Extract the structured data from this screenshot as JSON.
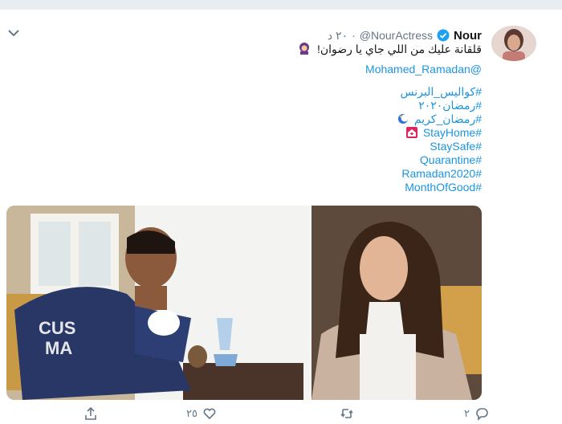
{
  "tweet": {
    "author_name": "Nour",
    "handle": "@NourActress",
    "time": "٢٠ د",
    "separator": "·",
    "text": "قلقانة عليك من اللي جاي يا رضوان!",
    "mention": "@Mohamed_Ramadan",
    "hashtags": [
      "#كواليس_البرنس",
      "#رمضان٢٠٢٠",
      "#رمضان_كريم",
      "#StayHome",
      "#StaySafe",
      "#Quarantine",
      "#Ramadan2020",
      "#MonthOfGood"
    ]
  },
  "actions": {
    "reply_count": "٢",
    "retweet_count": "",
    "like_count": "٢٥",
    "share_count": ""
  },
  "colors": {
    "link": "#1b95e0",
    "text": "#14171a",
    "secondary": "#657786",
    "verified": "#1da1f2"
  },
  "icons": [
    "chevron-down-icon",
    "verified-badge-icon",
    "woman-emoji-icon",
    "crescent-moon-emoji-icon",
    "house-emoji-icon",
    "reply-icon",
    "retweet-icon",
    "like-icon",
    "share-icon"
  ]
}
